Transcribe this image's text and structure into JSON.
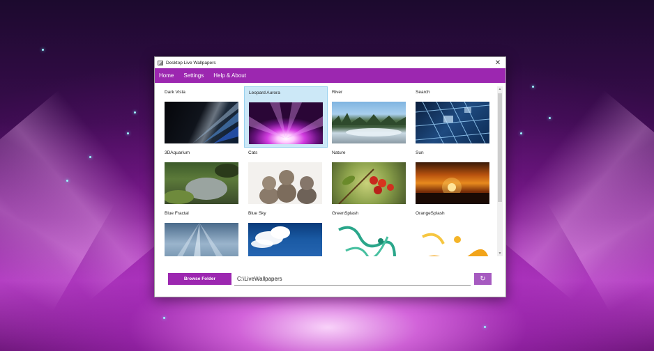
{
  "window": {
    "title": "Desktop Live Wallpapers",
    "close_glyph": "✕"
  },
  "menu": {
    "items": [
      "Home",
      "Settings",
      "Help & About"
    ]
  },
  "wallpapers": [
    {
      "label": "Dark Vista",
      "selected": false
    },
    {
      "label": "Leopard Aurora",
      "selected": true
    },
    {
      "label": "River",
      "selected": false
    },
    {
      "label": "Search",
      "selected": false
    },
    {
      "label": "3DAquarium",
      "selected": false
    },
    {
      "label": "Cats",
      "selected": false
    },
    {
      "label": "Nature",
      "selected": false
    },
    {
      "label": "Sun",
      "selected": false
    },
    {
      "label": "Blue Fractal",
      "selected": false
    },
    {
      "label": "Blue Sky",
      "selected": false
    },
    {
      "label": "GreenSplash",
      "selected": false
    },
    {
      "label": "OrangeSplash",
      "selected": false
    }
  ],
  "footer": {
    "browse_label": "Browse Folder",
    "path_value": "C:\\LiveWallpapers",
    "refresh_icon": "↻"
  },
  "colors": {
    "accent": "#9c27b0",
    "selection": "#cce8f7"
  }
}
